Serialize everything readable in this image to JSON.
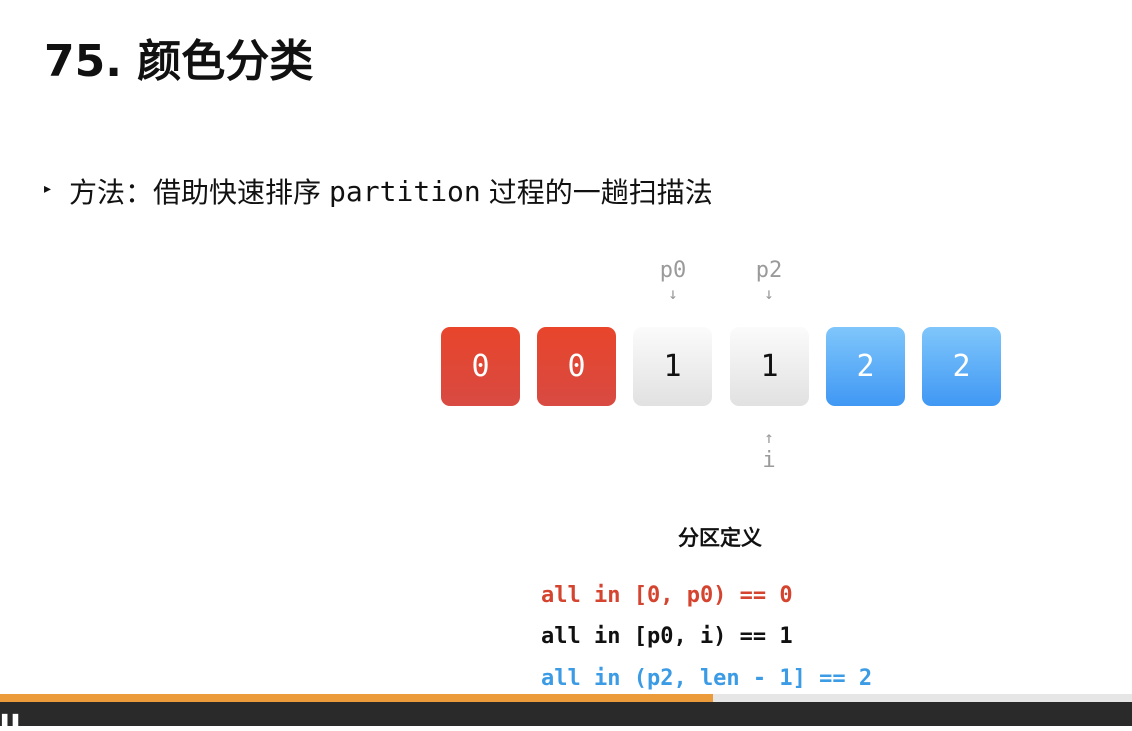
{
  "slide": {
    "title": "75. 颜色分类",
    "bullet": {
      "prefix": "方法：借助快速排序",
      "code": "partition",
      "suffix": "过程的一趟扫描法"
    },
    "pointers": {
      "p0": {
        "label": "p0",
        "arrow": "↓"
      },
      "p2": {
        "label": "p2",
        "arrow": "↓"
      },
      "i": {
        "label": "i",
        "arrow": "↑"
      }
    },
    "array": [
      "0",
      "0",
      "1",
      "1",
      "2",
      "2"
    ],
    "section_heading": "分区定义",
    "definitions": [
      "all in [0, p0) == 0",
      "all in [p0, i) == 1",
      "all in (p2, len - 1] == 2"
    ]
  },
  "colors": {
    "zero": "#e8452b",
    "one": "#f1f1f1",
    "two": "#4da3f6",
    "def_zero": "#d4442f",
    "def_one": "#111111",
    "def_two": "#3b9be5",
    "progress": "#ec9b3b"
  },
  "progress": {
    "fraction": 0.63
  },
  "bottom_bar": {
    "glyph": "▌▌"
  }
}
